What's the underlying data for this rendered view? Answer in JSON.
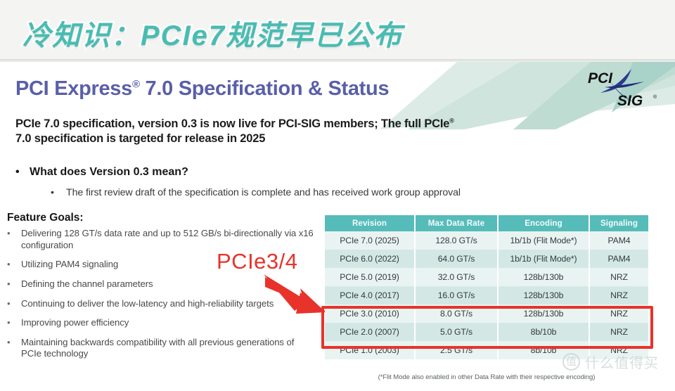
{
  "banner": {
    "title": "冷知识：PCIe7规范早已公布",
    "accent_color": "#49bcb2",
    "background_color": "#f4f5f2"
  },
  "slide": {
    "title_main": "PCI Express",
    "title_sup": "®",
    "title_rest": " 7.0 Specification & Status",
    "title_color": "#5a5fa8",
    "lead_line1": "PCIe 7.0 specification, version 0.3 is now live for PCI-SIG members; The full PCIe",
    "lead_sup": "®",
    "lead_line2": "7.0 specification is targeted for release in 2025",
    "question_bullet": "What does Version 0.3 mean?",
    "sub_bullet": "The first review draft of the specification is complete and has received work group approval",
    "bullet_glyph": "•"
  },
  "feature_goals": {
    "heading": "Feature Goals:",
    "items": [
      "Delivering 128 GT/s data rate and up to 512 GB/s bi-directionally via x16 configuration",
      "Utilizing PAM4 signaling",
      "Defining the channel parameters",
      "Continuing to deliver the low-latency and high-reliability targets",
      "Improving power efficiency",
      "Maintaining backwards compatibility with all previous generations of PCIe technology"
    ]
  },
  "annotation": {
    "label": "PCIe3/4",
    "color": "#e8332a",
    "highlight_rows": [
      "PCIe 4.0 (2017)",
      "PCIe 3.0 (2010)"
    ]
  },
  "table": {
    "header_color": "#56bcba",
    "columns": [
      "Revision",
      "Max Data Rate",
      "Encoding",
      "Signaling"
    ],
    "rows": [
      {
        "revision": "PCIe 7.0 (2025)",
        "rate": "128.0 GT/s",
        "encoding": "1b/1b (Flit Mode*)",
        "signaling": "PAM4"
      },
      {
        "revision": "PCIe 6.0 (2022)",
        "rate": "64.0 GT/s",
        "encoding": "1b/1b (Flit Mode*)",
        "signaling": "PAM4"
      },
      {
        "revision": "PCIe 5.0 (2019)",
        "rate": "32.0 GT/s",
        "encoding": "128b/130b",
        "signaling": "NRZ"
      },
      {
        "revision": "PCIe 4.0 (2017)",
        "rate": "16.0 GT/s",
        "encoding": "128b/130b",
        "signaling": "NRZ"
      },
      {
        "revision": "PCIe 3.0 (2010)",
        "rate": "8.0 GT/s",
        "encoding": "128b/130b",
        "signaling": "NRZ"
      },
      {
        "revision": "PCIe 2.0 (2007)",
        "rate": "5.0 GT/s",
        "encoding": "8b/10b",
        "signaling": "NRZ"
      },
      {
        "revision": "PCIe 1.0 (2003)",
        "rate": "2.5 GT/s",
        "encoding": "8b/10b",
        "signaling": "NRZ"
      }
    ],
    "footnote": "(*Flit Mode also enabled in other Data Rate with their respective encoding)"
  },
  "logo": {
    "top_text": "PCI",
    "bottom_text": "SIG",
    "registered": "®"
  },
  "watermark": {
    "mark": "值",
    "text": "什么值得买"
  }
}
